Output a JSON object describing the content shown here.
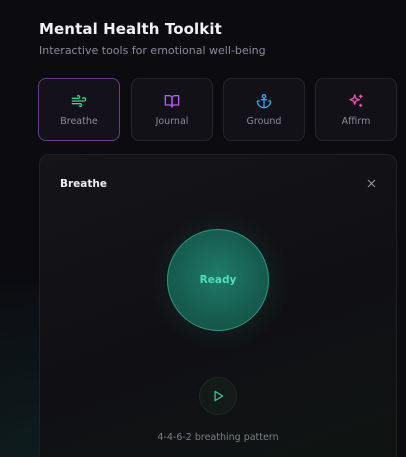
{
  "header": {
    "title": "Mental Health Toolkit",
    "subtitle": "Interactive tools for emotional well-being"
  },
  "tools": [
    {
      "label": "Breathe",
      "icon": "wind-icon",
      "color": "#3ecf8e",
      "active": true
    },
    {
      "label": "Journal",
      "icon": "book-open-icon",
      "color": "#b45cf0",
      "active": false
    },
    {
      "label": "Ground",
      "icon": "anchor-icon",
      "color": "#3b9ff0",
      "active": false
    },
    {
      "label": "Affirm",
      "icon": "sparkles-icon",
      "color": "#e84fb0",
      "active": false
    }
  ],
  "panel": {
    "title": "Breathe",
    "close_icon": "close-icon",
    "orb_text": "Ready",
    "play_icon": "play-icon",
    "pattern": "4-4-6-2 breathing pattern"
  },
  "colors": {
    "background": "#0b0b10",
    "accent_green": "#4fe0b8",
    "active_border": "#6a3a8c"
  }
}
